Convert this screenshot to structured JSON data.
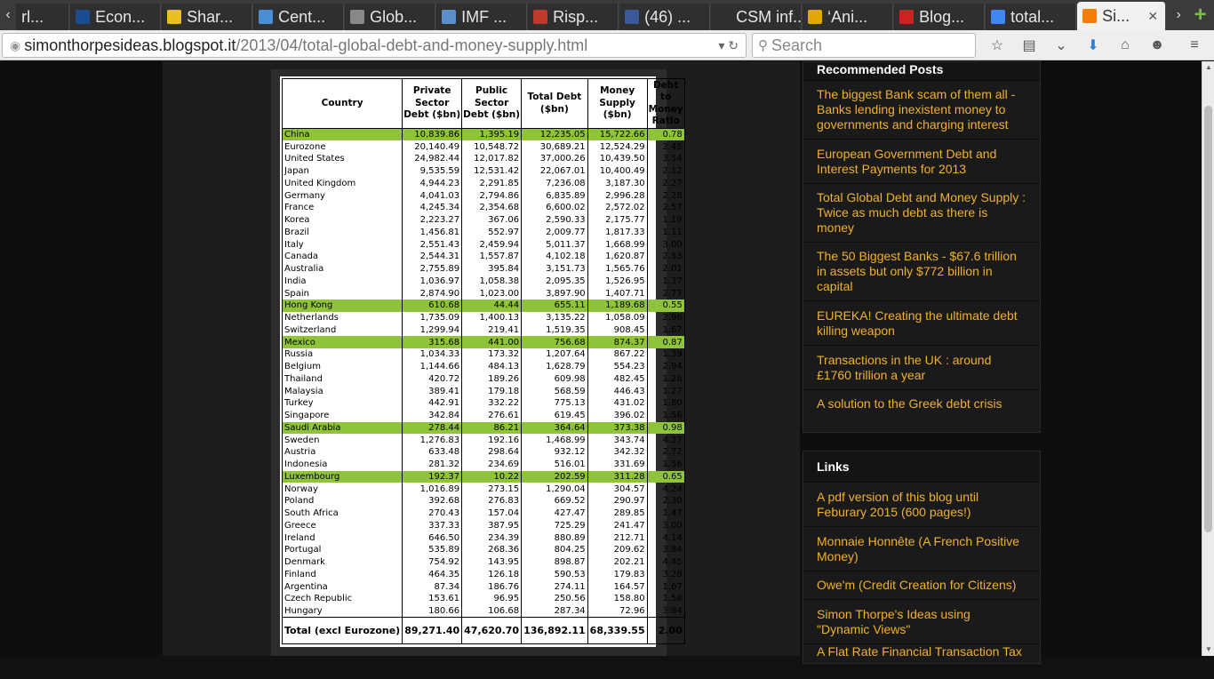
{
  "tabs": [
    {
      "label": "rl...",
      "color": "#cccccc"
    },
    {
      "label": "Econ...",
      "color": "#1a4d8f"
    },
    {
      "label": "Shar...",
      "color": "#e8c020"
    },
    {
      "label": "Cent...",
      "color": "#4a8fd4"
    },
    {
      "label": "Glob...",
      "color": "#888888"
    },
    {
      "label": "IMF ...",
      "color": "#5b8fc9"
    },
    {
      "label": "Risp...",
      "color": "#c0392b"
    },
    {
      "label": "(46) ...",
      "color": "#3b5998"
    },
    {
      "label": "CSM inf...",
      "color": "#2f2f2f"
    },
    {
      "label": "‘Ani...",
      "color": "#e0a800"
    },
    {
      "label": "Blog...",
      "color": "#cc2222"
    },
    {
      "label": "total...",
      "color": "#4285f4"
    },
    {
      "label": "Si...",
      "color": "#f57d00"
    }
  ],
  "nav": {
    "url_host": "simonthorpesideas.blogspot.it",
    "url_path": "/2013/04/total-global-debt-and-money-supply.html",
    "search_placeholder": "Search"
  },
  "table": {
    "headers": [
      "Country",
      "Private Sector Debt ($bn)",
      "Public Sector Debt ($bn)",
      "Total Debt ($bn)",
      "Money Supply ($bn)",
      "Debt to Money Ratio"
    ],
    "rows": [
      {
        "country": "China",
        "private": "10,839.86",
        "public": "1,395.19",
        "total": "12,235.05",
        "money": "15,722.66",
        "ratio": "0.78",
        "highlight": true
      },
      {
        "country": "Eurozone",
        "private": "20,140.49",
        "public": "10,548.72",
        "total": "30,689.21",
        "money": "12,524.29",
        "ratio": "2.45"
      },
      {
        "country": "United States",
        "private": "24,982.44",
        "public": "12,017.82",
        "total": "37,000.26",
        "money": "10,439.50",
        "ratio": "3.54"
      },
      {
        "country": "Japan",
        "private": "9,535.59",
        "public": "12,531.42",
        "total": "22,067.01",
        "money": "10,400.49",
        "ratio": "2.12"
      },
      {
        "country": "United Kingdom",
        "private": "4,944.23",
        "public": "2,291.85",
        "total": "7,236.08",
        "money": "3,187.30",
        "ratio": "2.27"
      },
      {
        "country": "Germany",
        "private": "4,041.03",
        "public": "2,794.86",
        "total": "6,835.89",
        "money": "2,996.28",
        "ratio": "2.28"
      },
      {
        "country": "France",
        "private": "4,245.34",
        "public": "2,354.68",
        "total": "6,600.02",
        "money": "2,572.02",
        "ratio": "2.57"
      },
      {
        "country": "Korea",
        "private": "2,223.27",
        "public": "367.06",
        "total": "2,590.33",
        "money": "2,175.77",
        "ratio": "1.19"
      },
      {
        "country": "Brazil",
        "private": "1,456.81",
        "public": "552.97",
        "total": "2,009.77",
        "money": "1,817.33",
        "ratio": "1.11"
      },
      {
        "country": "Italy",
        "private": "2,551.43",
        "public": "2,459.94",
        "total": "5,011.37",
        "money": "1,668.99",
        "ratio": "3.00"
      },
      {
        "country": "Canada",
        "private": "2,544.31",
        "public": "1,557.87",
        "total": "4,102.18",
        "money": "1,620.87",
        "ratio": "2.53"
      },
      {
        "country": "Australia",
        "private": "2,755.89",
        "public": "395.84",
        "total": "3,151.73",
        "money": "1,565.76",
        "ratio": "2.01"
      },
      {
        "country": "India",
        "private": "1,036.97",
        "public": "1,058.38",
        "total": "2,095.35",
        "money": "1,526.95",
        "ratio": "1.37"
      },
      {
        "country": "Spain",
        "private": "2,874.90",
        "public": "1,023.00",
        "total": "3,897.90",
        "money": "1,407.71",
        "ratio": "2.77"
      },
      {
        "country": "Hong Kong",
        "private": "610.68",
        "public": "44.44",
        "total": "655.11",
        "money": "1,189.68",
        "ratio": "0.55",
        "highlight": true
      },
      {
        "country": "Netherlands",
        "private": "1,735.09",
        "public": "1,400.13",
        "total": "3,135.22",
        "money": "1,058.09",
        "ratio": "2.96"
      },
      {
        "country": "Switzerland",
        "private": "1,299.94",
        "public": "219.41",
        "total": "1,519.35",
        "money": "908.45",
        "ratio": "1.67"
      },
      {
        "country": "Mexico",
        "private": "315.68",
        "public": "441.00",
        "total": "756.68",
        "money": "874.37",
        "ratio": "0.87",
        "highlight": true
      },
      {
        "country": "Russia",
        "private": "1,034.33",
        "public": "173.32",
        "total": "1,207.64",
        "money": "867.22",
        "ratio": "1.39"
      },
      {
        "country": "Belgium",
        "private": "1,144.66",
        "public": "484.13",
        "total": "1,628.79",
        "money": "554.23",
        "ratio": "2.94"
      },
      {
        "country": "Thailand",
        "private": "420.72",
        "public": "189.26",
        "total": "609.98",
        "money": "482.45",
        "ratio": "1.26"
      },
      {
        "country": "Malaysia",
        "private": "389.41",
        "public": "179.18",
        "total": "568.59",
        "money": "446.43",
        "ratio": "1.27"
      },
      {
        "country": "Turkey",
        "private": "442.91",
        "public": "332.22",
        "total": "775.13",
        "money": "431.02",
        "ratio": "1.80"
      },
      {
        "country": "Singapore",
        "private": "342.84",
        "public": "276.61",
        "total": "619.45",
        "money": "396.02",
        "ratio": "1.56"
      },
      {
        "country": "Saudi Arabia",
        "private": "278.44",
        "public": "86.21",
        "total": "364.64",
        "money": "373.38",
        "ratio": "0.98",
        "highlight": true
      },
      {
        "country": "Sweden",
        "private": "1,276.83",
        "public": "192.16",
        "total": "1,468.99",
        "money": "343.74",
        "ratio": "4.27"
      },
      {
        "country": "Austria",
        "private": "633.48",
        "public": "298.64",
        "total": "932.12",
        "money": "342.32",
        "ratio": "2.72"
      },
      {
        "country": "Indonesia",
        "private": "281.32",
        "public": "234.69",
        "total": "516.01",
        "money": "331.69",
        "ratio": "1.56"
      },
      {
        "country": "Luxembourg",
        "private": "192.37",
        "public": "10.22",
        "total": "202.59",
        "money": "311.28",
        "ratio": "0.65",
        "highlight": true
      },
      {
        "country": "Norway",
        "private": "1,016.89",
        "public": "273.15",
        "total": "1,290.04",
        "money": "304.57",
        "ratio": "4.24"
      },
      {
        "country": "Poland",
        "private": "392.68",
        "public": "276.83",
        "total": "669.52",
        "money": "290.97",
        "ratio": "2.30"
      },
      {
        "country": "South Africa",
        "private": "270.43",
        "public": "157.04",
        "total": "427.47",
        "money": "289.85",
        "ratio": "1.47"
      },
      {
        "country": "Greece",
        "private": "337.33",
        "public": "387.95",
        "total": "725.29",
        "money": "241.47",
        "ratio": "3.00"
      },
      {
        "country": "Ireland",
        "private": "646.50",
        "public": "234.39",
        "total": "880.89",
        "money": "212.71",
        "ratio": "4.14"
      },
      {
        "country": "Portugal",
        "private": "535.89",
        "public": "268.36",
        "total": "804.25",
        "money": "209.62",
        "ratio": "3.84"
      },
      {
        "country": "Denmark",
        "private": "754.92",
        "public": "143.95",
        "total": "898.87",
        "money": "202.21",
        "ratio": "4.45"
      },
      {
        "country": "Finland",
        "private": "464.35",
        "public": "126.18",
        "total": "590.53",
        "money": "179.83",
        "ratio": "3.28"
      },
      {
        "country": "Argentina",
        "private": "87.34",
        "public": "186.76",
        "total": "274.11",
        "money": "164.57",
        "ratio": "1.67"
      },
      {
        "country": "Czech Republic",
        "private": "153.61",
        "public": "96.95",
        "total": "250.56",
        "money": "158.80",
        "ratio": "1.58"
      },
      {
        "country": "Hungary",
        "private": "180.66",
        "public": "106.68",
        "total": "287.34",
        "money": "72.96",
        "ratio": "3.94"
      }
    ],
    "total_row": {
      "country": "Total (excl Eurozone)",
      "private": "89,271.40",
      "public": "47,620.70",
      "total": "136,892.11",
      "money": "68,339.55",
      "ratio": "2.00"
    }
  },
  "recommended": {
    "title": "Recommended Posts",
    "items": [
      "The biggest Bank scam of them all - Banks lending inexistent money to governments and charging interest",
      "European Government Debt and Interest Payments for 2013",
      "Total Global Debt and Money Supply : Twice as much debt as there is money",
      "The 50 Biggest Banks - $67.6 trillion in assets but only $772 billion in capital",
      "EUREKA! Creating the ultimate debt killing weapon",
      "Transactions in the UK : around £1760 trillion a year",
      "A solution to the Greek debt crisis"
    ]
  },
  "links": {
    "title": "Links",
    "items": [
      "A pdf version of this blog until Feburary 2015 (600 pages!)",
      "Monnaie Honnête (A French Positive Money)",
      "Owe'm (Credit Creation for Citizens)",
      "Simon Thorpe's Ideas using \"Dynamic Views\"",
      "A Flat Rate Financial Transaction Tax"
    ]
  }
}
